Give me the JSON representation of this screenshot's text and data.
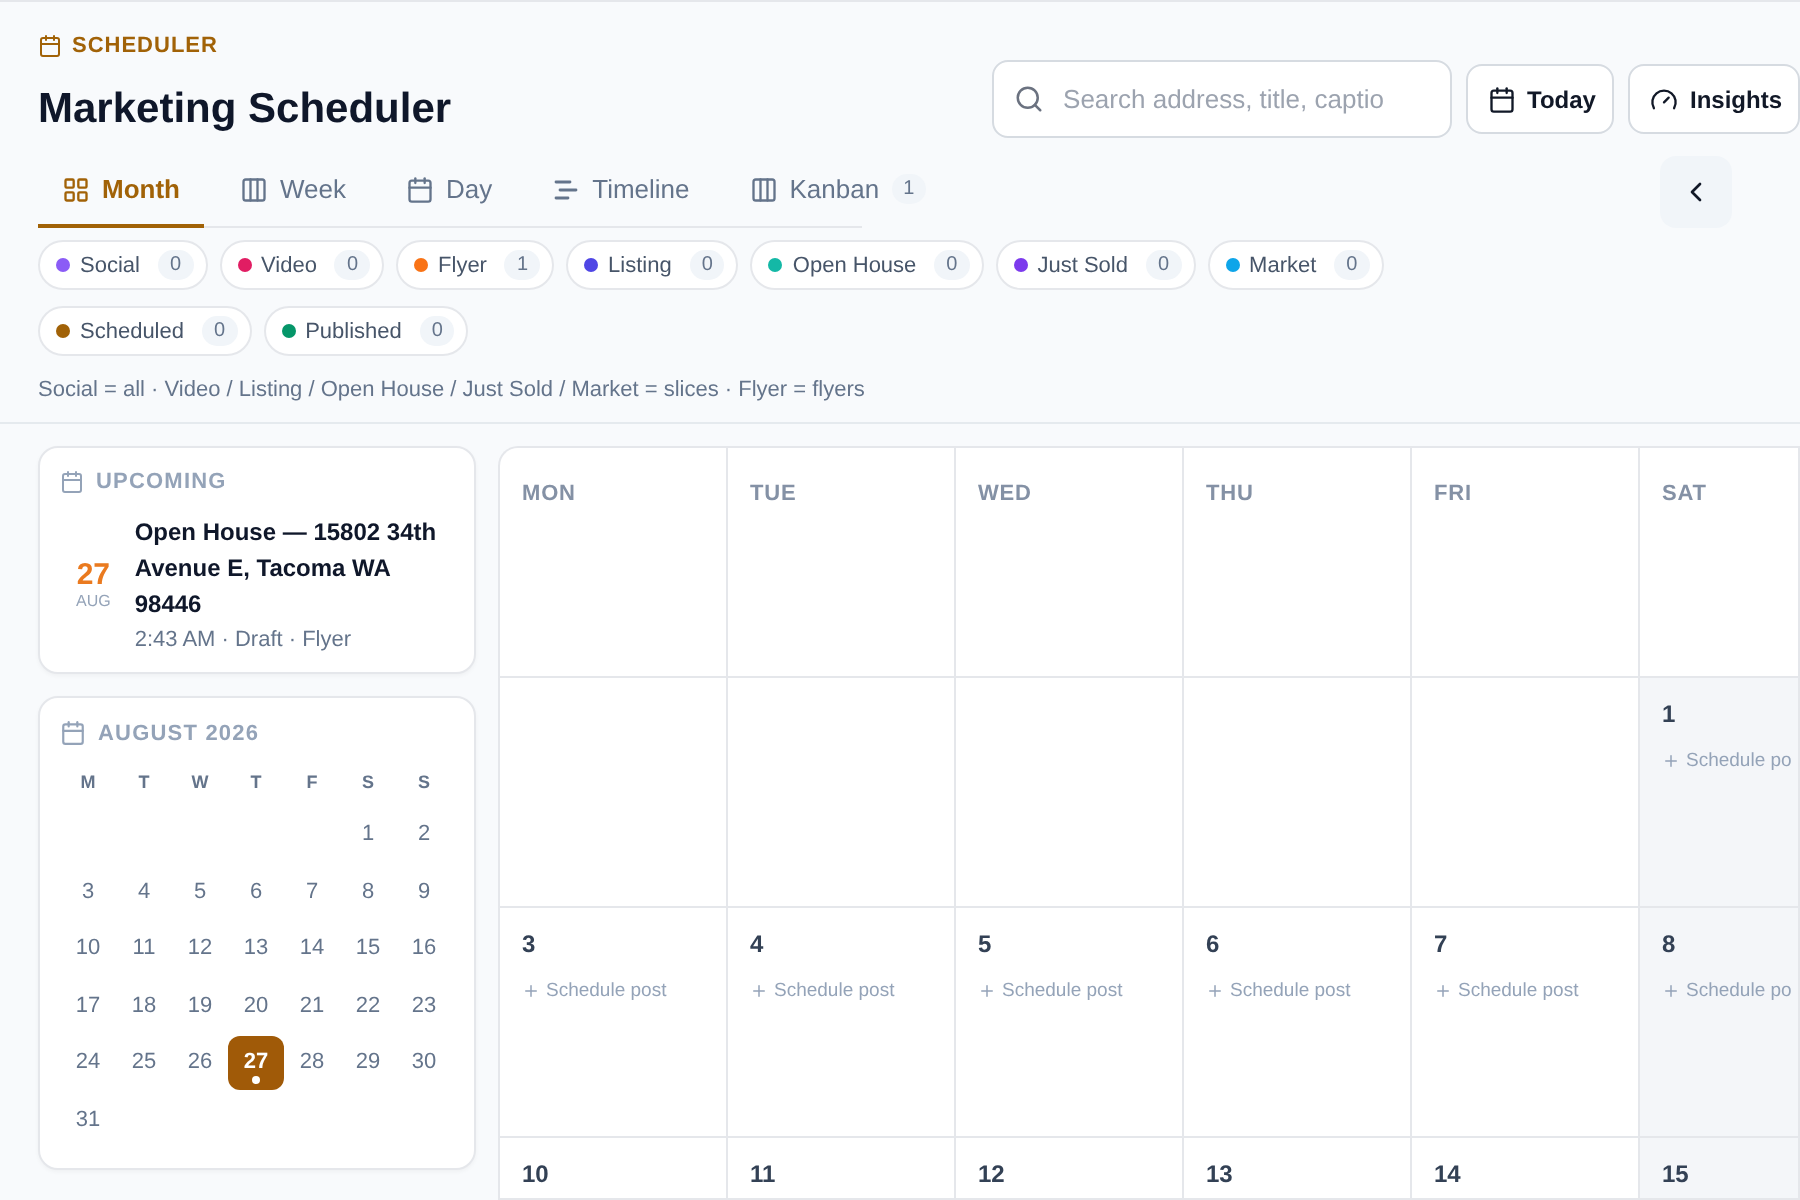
{
  "header": {
    "eyebrow": "SCHEDULER",
    "title": "Marketing Scheduler",
    "search": {
      "placeholder": "Search address, title, captio"
    },
    "buttons": [
      "Today",
      "Insights"
    ]
  },
  "tabs": [
    {
      "label": "Month",
      "selected": true
    },
    {
      "label": "Week",
      "selected": false
    },
    {
      "label": "Day",
      "selected": false
    },
    {
      "label": "Timeline",
      "selected": false
    },
    {
      "label": "Kanban",
      "selected": false,
      "badge": "1"
    }
  ],
  "filters": [
    {
      "label": "Social",
      "count": "0",
      "color": "#8b5cf6"
    },
    {
      "label": "Video",
      "count": "0",
      "color": "#e11d63"
    },
    {
      "label": "Flyer",
      "count": "1",
      "color": "#f97316"
    },
    {
      "label": "Listing",
      "count": "0",
      "color": "#4f46e5"
    },
    {
      "label": "Open House",
      "count": "0",
      "color": "#14b8a6"
    },
    {
      "label": "Just Sold",
      "count": "0",
      "color": "#7c3aed"
    },
    {
      "label": "Market",
      "count": "0",
      "color": "#0ea5e9"
    },
    {
      "label": "Scheduled",
      "count": "0",
      "color": "#a16207"
    },
    {
      "label": "Published",
      "count": "0",
      "color": "#059669"
    }
  ],
  "legend": "Social = all · Video / Listing / Open House / Just Sold / Market = slices · Flyer = flyers",
  "upcoming": {
    "title": "UPCOMING",
    "items": [
      {
        "day": "27",
        "month": "AUG",
        "title": "Open House — 15802 34th Avenue E, Tacoma WA 98446",
        "meta": "2:43 AM · Draft · Flyer"
      }
    ]
  },
  "mini_calendar": {
    "title": "AUGUST 2026",
    "weekdays": [
      "M",
      "T",
      "W",
      "T",
      "F",
      "S",
      "S"
    ],
    "weeks": [
      [
        {
          "label": "1",
          "selected": false,
          "has_event": false
        },
        {
          "label": "2",
          "selected": false,
          "has_event": false
        }
      ],
      [
        {
          "label": "3",
          "selected": false,
          "has_event": false
        },
        {
          "label": "4",
          "selected": false,
          "has_event": false
        },
        {
          "label": "5",
          "selected": false,
          "has_event": false
        },
        {
          "label": "6",
          "selected": false,
          "has_event": false
        },
        {
          "label": "7",
          "selected": false,
          "has_event": false
        },
        {
          "label": "8",
          "selected": false,
          "has_event": false
        },
        {
          "label": "9",
          "selected": false,
          "has_event": false
        }
      ],
      [
        {
          "label": "10",
          "selected": false,
          "has_event": false
        },
        {
          "label": "11",
          "selected": false,
          "has_event": false
        },
        {
          "label": "12",
          "selected": false,
          "has_event": false
        },
        {
          "label": "13",
          "selected": false,
          "has_event": false
        },
        {
          "label": "14",
          "selected": false,
          "has_event": false
        },
        {
          "label": "15",
          "selected": false,
          "has_event": false
        },
        {
          "label": "16",
          "selected": false,
          "has_event": false
        }
      ],
      [
        {
          "label": "17",
          "selected": false,
          "has_event": false
        },
        {
          "label": "18",
          "selected": false,
          "has_event": false
        },
        {
          "label": "19",
          "selected": false,
          "has_event": false
        },
        {
          "label": "20",
          "selected": false,
          "has_event": false
        },
        {
          "label": "21",
          "selected": false,
          "has_event": false
        },
        {
          "label": "22",
          "selected": false,
          "has_event": false
        },
        {
          "label": "23",
          "selected": false,
          "has_event": false
        }
      ],
      [
        {
          "label": "24",
          "selected": false,
          "has_event": false
        },
        {
          "label": "25",
          "selected": false,
          "has_event": false
        },
        {
          "label": "26",
          "selected": false,
          "has_event": false
        },
        {
          "label": "27",
          "selected": true,
          "has_event": true
        },
        {
          "label": "28",
          "selected": false,
          "has_event": false
        },
        {
          "label": "29",
          "selected": false,
          "has_event": false
        },
        {
          "label": "30",
          "selected": false,
          "has_event": false
        }
      ],
      [
        {
          "label": "31",
          "selected": false,
          "has_event": false
        }
      ]
    ]
  },
  "month_grid": {
    "weekdays": [
      "MON",
      "TUE",
      "WED",
      "THU",
      "FRI",
      "SAT"
    ],
    "weeks": [
      [
        {
          "day": "1",
          "action": "Schedule po"
        }
      ],
      [
        {
          "day": "3",
          "action": "Schedule post"
        },
        {
          "day": "4",
          "action": "Schedule post"
        },
        {
          "day": "5",
          "action": "Schedule post"
        },
        {
          "day": "6",
          "action": "Schedule post"
        },
        {
          "day": "7",
          "action": "Schedule post"
        },
        {
          "day": "8",
          "action": "Schedule po"
        }
      ],
      [
        {
          "day": "10"
        },
        {
          "day": "11"
        },
        {
          "day": "12"
        },
        {
          "day": "13"
        },
        {
          "day": "14"
        },
        {
          "day": "15"
        }
      ]
    ]
  }
}
